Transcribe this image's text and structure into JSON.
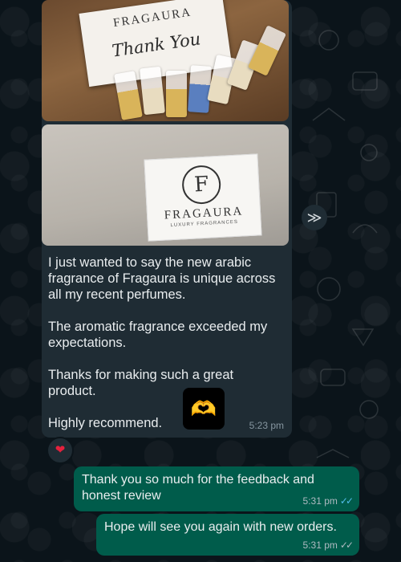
{
  "chat": {
    "incoming": {
      "image1": {
        "card_brand": "FRAGAURA",
        "card_thanks": "Thank You"
      },
      "image2": {
        "logo_letter": "F",
        "box_brand": "FRAGAURA",
        "box_sub": "LUXURY FRAGRANCES"
      },
      "text": "I just wanted to say the new arabic fragrance of Fragaura is unique across all my recent perfumes.\n\nThe aromatic fragrance exceeded my expectations.\n\nThanks for making such a great product.\n\nHighly recommend.",
      "sticker_icon": "heart-hands-emoji",
      "sticker_glyph": "🫶",
      "time": "5:23 pm",
      "reaction": "❤"
    },
    "forward_icon": "forward-icon",
    "forward_glyph": "≫",
    "outgoing": [
      {
        "text": "Thank you so much for the feedback and honest review",
        "time": "5:31 pm",
        "ticks": "✓✓",
        "status": "read"
      },
      {
        "text": "Hope will see you again with new orders.",
        "time": "5:31 pm",
        "ticks": "✓✓",
        "status": "delivered"
      }
    ],
    "colors": {
      "background": "#0b141a",
      "incoming_bubble": "#1f2c34",
      "outgoing_bubble": "#005c4b",
      "read_tick": "#53bdeb"
    }
  }
}
